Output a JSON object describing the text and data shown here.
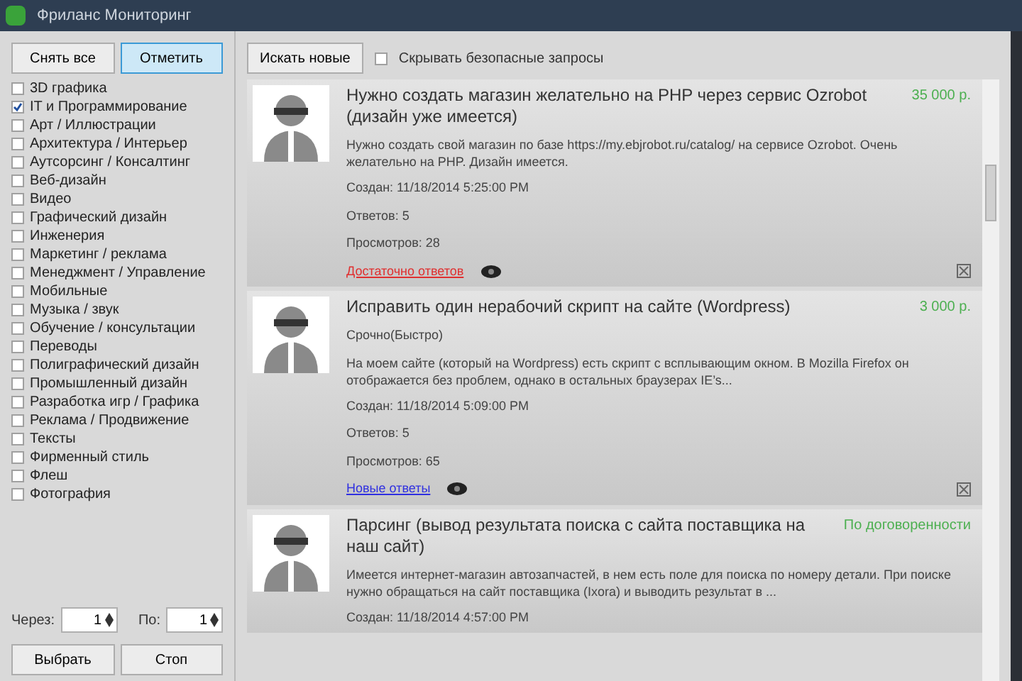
{
  "window": {
    "title": "Фриланс Мониторинг"
  },
  "left_panel": {
    "buttons": [
      {
        "label": "Снять все",
        "selected": false
      },
      {
        "label": "Отметить",
        "selected": true
      }
    ],
    "categories": [
      {
        "label": "3D графика",
        "checked": false
      },
      {
        "label": "IT и Программирование",
        "checked": true
      },
      {
        "label": "Арт / Иллюстрации",
        "checked": false
      },
      {
        "label": "Архитектура / Интерьер",
        "checked": false
      },
      {
        "label": "Аутсорсинг / Консалтинг",
        "checked": false
      },
      {
        "label": "Веб-дизайн",
        "checked": false
      },
      {
        "label": "Видео",
        "checked": false
      },
      {
        "label": "Графический дизайн",
        "checked": false
      },
      {
        "label": "Инженерия",
        "checked": false
      },
      {
        "label": "Маркетинг / реклама",
        "checked": false
      },
      {
        "label": "Менеджмент / Управление",
        "checked": false
      },
      {
        "label": "Мобильные",
        "checked": false
      },
      {
        "label": "Музыка / звук",
        "checked": false
      },
      {
        "label": "Обучение / консультации",
        "checked": false
      },
      {
        "label": "Переводы",
        "checked": false
      },
      {
        "label": "Полиграфический дизайн",
        "checked": false
      },
      {
        "label": "Промышленный дизайн",
        "checked": false
      },
      {
        "label": "Разработка игр / Графика",
        "checked": false
      },
      {
        "label": "Реклама / Продвижение",
        "checked": false
      },
      {
        "label": "Тексты",
        "checked": false
      },
      {
        "label": "Фирменный стиль",
        "checked": false
      },
      {
        "label": "Флеш",
        "checked": false
      },
      {
        "label": "Фотография",
        "checked": false
      }
    ],
    "spinners": [
      {
        "label": "Через:",
        "value": "1"
      },
      {
        "label": "По:",
        "value": "1"
      }
    ],
    "actions": [
      "Выбрать",
      "Стоп"
    ]
  },
  "toolbar": {
    "search_button": "Искать новые",
    "option": {
      "label": "Скрывать безопасные запросы",
      "checked": false
    }
  },
  "projects": [
    {
      "title": "Нужно создать магазин желательно на PHP через сервис Ozrobot (дизайн уже имеется)",
      "price": "35 000 р.",
      "description": "Нужно создать свой магазин по базе https://my.ebjrobot.ru/catalog/ на сервисе Ozrobot. Очень желательно на PHP. Дизайн имеется.",
      "created": "Создан: 11/18/2014 5:25:00 PM",
      "answers": "Ответов: 5",
      "views": "Просмотров: 28",
      "link": {
        "label": "Достаточно ответов",
        "kind": "warning"
      }
    },
    {
      "title": "Исправить один нерабочий скрипт на сайте (Wordpress)",
      "price": "3 000 р.",
      "subtitle": "Срочно(Быстро)",
      "description": "На моем сайте (который на Wordpress) есть скрипт с всплывающим окном. В Mozilla Firefox он отображается без проблем, однако в остальных браузерах IE’s...",
      "created": "Создан: 11/18/2014 5:09:00 PM",
      "answers": "Ответов: 5",
      "views": "Просмотров: 65",
      "link": {
        "label": "Новые ответы",
        "kind": "info"
      }
    },
    {
      "title": "Парсинг (вывод результата поиска с сайта поставщика на наш сайт)",
      "price": "По договоренности",
      "description": "Имеется интернет-магазин автозапчастей, в нем есть поле для поиска по номеру детали. При поиске нужно обращаться на сайт поставщика (Ixora) и выводить результат в ...",
      "created": "Создан: 11/18/2014 4:57:00 PM"
    }
  ]
}
